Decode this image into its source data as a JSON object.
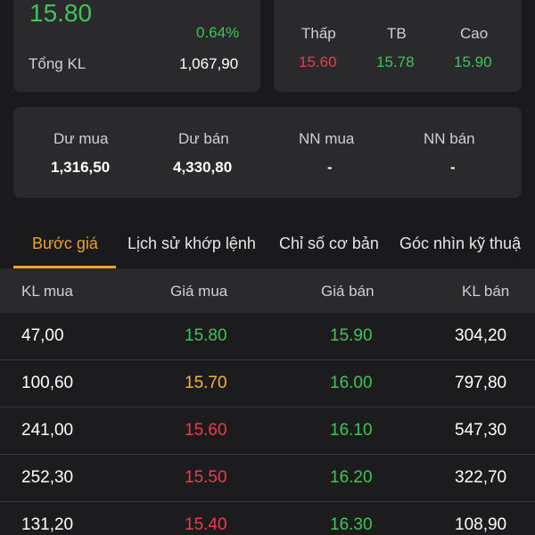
{
  "price_card": {
    "last_price": "15.80",
    "change_pct": "0.64%",
    "total_volume_label": "Tổng KL",
    "total_volume": "1,067,90"
  },
  "ohlc_card": {
    "low_label": "Thấp",
    "avg_label": "TB",
    "high_label": "Cao",
    "low": "15.60",
    "avg": "15.78",
    "high": "15.90"
  },
  "trade_card": {
    "buy_surplus_label": "Dư mua",
    "sell_surplus_label": "Dư bán",
    "foreign_buy_label": "NN mua",
    "foreign_sell_label": "NN bán",
    "buy_surplus": "1,316,50",
    "sell_surplus": "4,330,80",
    "foreign_buy": "-",
    "foreign_sell": "-"
  },
  "tabs": [
    {
      "label": "Bước giá",
      "active": true
    },
    {
      "label": "Lịch sử khớp lệnh",
      "active": false
    },
    {
      "label": "Chỉ số cơ bản",
      "active": false
    },
    {
      "label": "Góc nhìn kỹ thuậ",
      "active": false
    }
  ],
  "order_book": {
    "headers": {
      "buy_vol": "KL mua",
      "buy_price": "Giá mua",
      "sell_price": "Giá bán",
      "sell_vol": "KL bán"
    },
    "rows": [
      {
        "buy_vol": "47,00",
        "buy_price": "15.80",
        "buy_color": "green",
        "sell_price": "15.90",
        "sell_vol": "304,20"
      },
      {
        "buy_vol": "100,60",
        "buy_price": "15.70",
        "buy_color": "yellow",
        "sell_price": "16.00",
        "sell_vol": "797,80"
      },
      {
        "buy_vol": "241,00",
        "buy_price": "15.60",
        "buy_color": "red",
        "sell_price": "16.10",
        "sell_vol": "547,30"
      },
      {
        "buy_vol": "252,30",
        "buy_price": "15.50",
        "buy_color": "red",
        "sell_price": "16.20",
        "sell_vol": "322,70"
      },
      {
        "buy_vol": "131,20",
        "buy_price": "15.40",
        "buy_color": "red",
        "sell_price": "16.30",
        "sell_vol": "108,90"
      }
    ]
  },
  "colors": {
    "up": "#3fc45a",
    "reference": "#f0b33a",
    "down": "#ee3a4e",
    "accent": "#f0a228"
  }
}
